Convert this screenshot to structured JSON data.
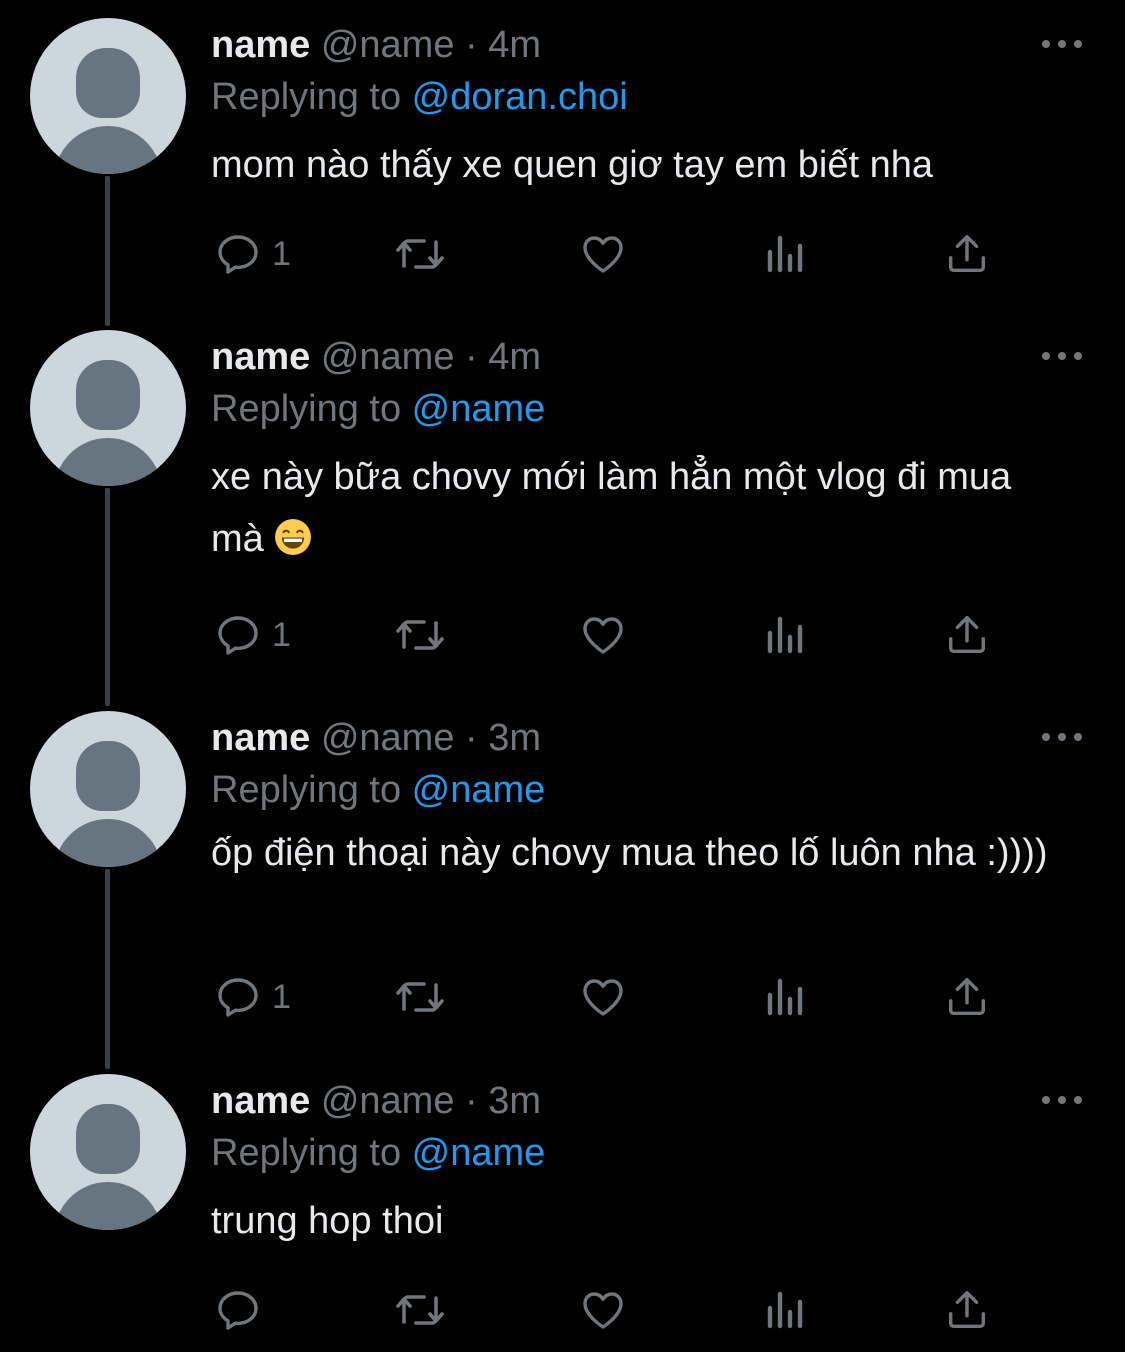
{
  "colors": {
    "background": "#000000",
    "text_primary": "#e7e9ea",
    "text_secondary": "#71767b",
    "accent": "#1d9bf0",
    "thread_line": "#3a4047",
    "avatar_bg": "#ccd6dd",
    "avatar_fg": "#66757f"
  },
  "icons": {
    "more": "more-horizontal-icon",
    "reply": "reply-bubble-icon",
    "retweet": "retweet-icon",
    "like": "heart-icon",
    "views": "views-bar-chart-icon",
    "share": "share-upload-icon",
    "avatar": "default-avatar-icon"
  },
  "tweets": [
    {
      "display_name": "name",
      "handle": "@name",
      "separator": "·",
      "time": "4m",
      "replying_prefix": "Replying to ",
      "replying_to": "@doran.choi",
      "text": "mom nào thấy xe quen giơ tay em biết nha",
      "reply_count": "1"
    },
    {
      "display_name": "name",
      "handle": "@name",
      "separator": "·",
      "time": "4m",
      "replying_prefix": "Replying to ",
      "replying_to": "@name",
      "text": "xe này bữa chovy mới làm hẳn một vlog đi mua mà",
      "emoji": "grinning-face-with-smiling-eyes",
      "reply_count": "1"
    },
    {
      "display_name": "name",
      "handle": "@name",
      "separator": "·",
      "time": "3m",
      "replying_prefix": "Replying to ",
      "replying_to": "@name",
      "text": "ốp điện thoại này chovy mua theo lố luôn nha :))))",
      "reply_count": "1"
    },
    {
      "display_name": "name",
      "handle": "@name",
      "separator": "·",
      "time": "3m",
      "replying_prefix": "Replying to ",
      "replying_to": "@name",
      "text": "trung hop thoi",
      "reply_count": ""
    }
  ]
}
